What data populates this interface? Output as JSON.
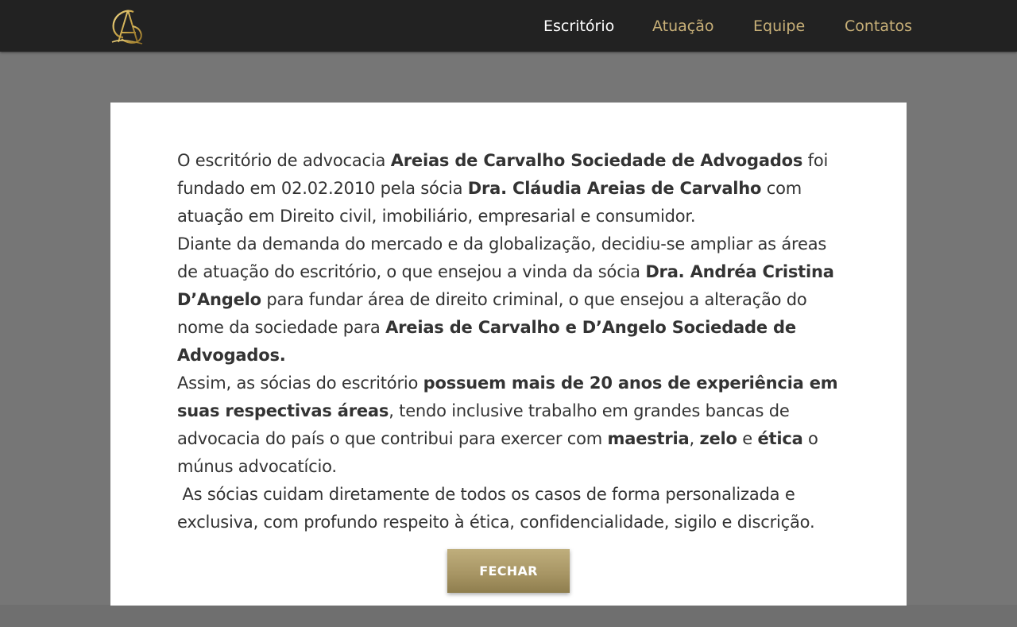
{
  "header": {
    "logo_icon": "monogram-logo-icon",
    "nav": [
      {
        "label": "Escritório",
        "active": true
      },
      {
        "label": "Atuação",
        "active": false
      },
      {
        "label": "Equipe",
        "active": false
      },
      {
        "label": "Contatos",
        "active": false
      }
    ]
  },
  "colors": {
    "navbar_bg": "#222222",
    "nav_link": "#c8b078",
    "nav_active": "#ffffff",
    "overlay": "#767676",
    "button_gold": "#a89665"
  },
  "modal": {
    "p1": {
      "t1": "O escritório de advocacia ",
      "b1": "Areias de Carvalho Sociedade de Advogados",
      "t2": " foi fundado em 02.02.2010 pela sócia ",
      "b2": "Dra. Cláudia Areias de Carvalho",
      "t3": " com atuação em Direito civil, imobiliário, empresarial e consumidor."
    },
    "p2": {
      "t1": "Diante da demanda do mercado e da globalização, decidiu-se ampliar as áreas de atuação do escritório, o que ensejou a vinda da sócia ",
      "b1": "Dra. Andréa Cristina D’Angelo",
      "t2": " para fundar área de direito criminal, o que ensejou a alteração do nome da sociedade para ",
      "b2": "Areias de Carvalho e D’Angelo Sociedade de Advogados."
    },
    "p3": {
      "t1": "Assim, as sócias do escritório ",
      "b1": "possuem mais de 20 anos de experiência em suas respectivas áreas",
      "t2": ", tendo inclusive trabalho em grandes bancas de advocacia do país o que contribui para exercer com ",
      "b2": "maestria",
      "t3": ", ",
      "b3": "zelo",
      "t4": " e ",
      "b4": "ética",
      "t5": " o múnus advocatício."
    },
    "p4": {
      "t1": " As sócias cuidam diretamente de todos os casos de forma personalizada e exclusiva, com profundo respeito à ética, confidencialidade, sigilo e discrição."
    },
    "close_label": "FECHAR"
  }
}
